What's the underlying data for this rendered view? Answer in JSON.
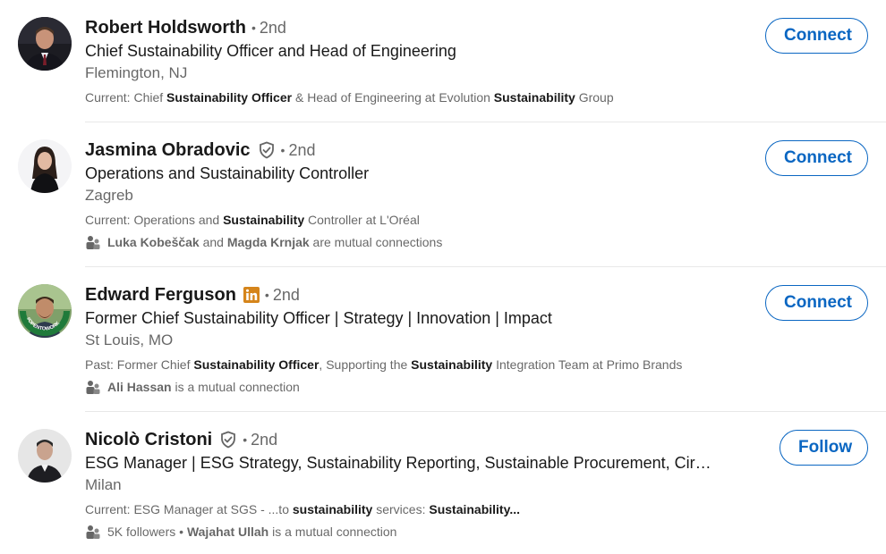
{
  "colors": {
    "accent": "#0a66c2",
    "linkedin_badge": "#d5851b",
    "text_primary": "rgba(0,0,0,0.9)",
    "text_secondary": "rgba(0,0,0,0.6)"
  },
  "people": [
    {
      "name": "Robert Holdsworth",
      "degree": "2nd",
      "headline": "Chief Sustainability Officer and Head of Engineering",
      "location": "Flemington, NJ",
      "summary_prefix": "Current: Chief ",
      "summary_b1": "Sustainability Officer",
      "summary_mid": " & Head of Engineering at Evolution ",
      "summary_b2": "Sustainability",
      "summary_suffix": " Group",
      "action": "Connect"
    },
    {
      "name": "Jasmina Obradovic",
      "badge": "verified-shield-icon",
      "degree": "2nd",
      "headline": "Operations and Sustainability Controller",
      "location": "Zagreb",
      "summary_prefix": "Current: Operations and ",
      "summary_b1": "Sustainability",
      "summary_suffix": " Controller at L'Oréal",
      "mutual_a": "Luka Kobeščak",
      "mutual_and": " and ",
      "mutual_b": "Magda Krnjak",
      "mutual_suffix": " are mutual connections",
      "action": "Connect"
    },
    {
      "name": "Edward Ferguson",
      "badge": "linkedin-icon",
      "degree": "2nd",
      "headline": "Former Chief Sustainability Officer | Strategy | Innovation | Impact",
      "location": "St Louis, MO",
      "summary_prefix": "Past: Former Chief ",
      "summary_b1": "Sustainability Officer",
      "summary_mid": ", Supporting the ",
      "summary_b2": "Sustainability",
      "summary_suffix": " Integration Team at Primo Brands",
      "mutual_a": "Ali Hassan",
      "mutual_suffix": " is a mutual connection",
      "avatar_frame_text": "#OPENTOWORK",
      "action": "Connect"
    },
    {
      "name": "Nicolò Cristoni",
      "badge": "verified-shield-icon",
      "degree": "2nd",
      "headline": "ESG Manager | ESG Strategy, Sustainability Reporting, Sustainable Procurement, Circular...",
      "location": "Milan",
      "summary_prefix": "Current: ESG Manager at SGS - ...to ",
      "summary_b1": "sustainability",
      "summary_mid": " services: ",
      "summary_b2": "Sustainability...",
      "followers": "5K followers",
      "mutual_sep": " • ",
      "mutual_a": "Wajahat Ullah",
      "mutual_suffix": " is a mutual connection",
      "action": "Follow"
    }
  ]
}
